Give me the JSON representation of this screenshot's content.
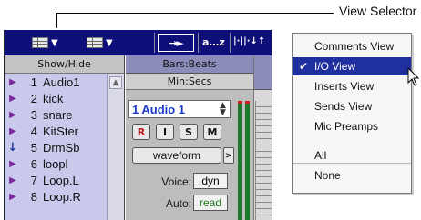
{
  "callout": {
    "label": "View Selector"
  },
  "toolbar": {
    "view_selector_symbol": "→►",
    "sort_label": "a…z",
    "sort_extra": "|·||·↓↑"
  },
  "tracks_panel": {
    "header": "Show/Hide",
    "tracks": [
      {
        "num": "1",
        "name": "Audio1"
      },
      {
        "num": "2",
        "name": "kick"
      },
      {
        "num": "3",
        "name": "snare"
      },
      {
        "num": "4",
        "name": "KitSter"
      },
      {
        "num": "5",
        "name": "DrmSb"
      },
      {
        "num": "6",
        "name": "loopl"
      },
      {
        "num": "7",
        "name": "Loop.L"
      },
      {
        "num": "8",
        "name": "Loop.R"
      }
    ]
  },
  "rulers": {
    "bars_beats": "Bars:Beats",
    "min_secs": "Min:Secs"
  },
  "track_io": {
    "name": "1 Audio 1",
    "buttons": {
      "record": "R",
      "input": "I",
      "solo": "S",
      "mute": "M"
    },
    "waveform": "waveform",
    "voice_label": "Voice:",
    "voice_value": "dyn",
    "auto_label": "Auto:",
    "auto_value": "read"
  },
  "view_menu": {
    "items": [
      "Comments View",
      "I/O View",
      "Inserts View",
      "Sends View",
      "Mic Preamps",
      "All",
      "None"
    ],
    "selected": "I/O View"
  }
}
